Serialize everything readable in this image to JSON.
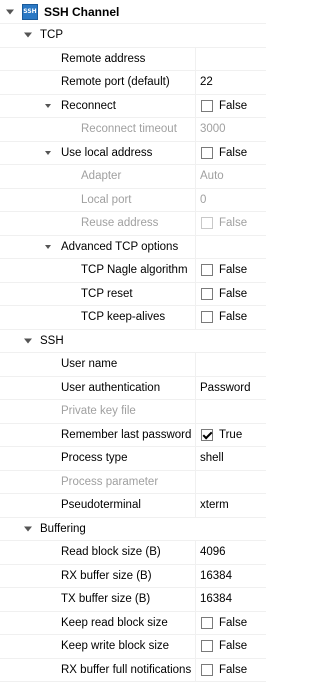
{
  "header": {
    "icon_text": "SSH",
    "title": "SSH Channel"
  },
  "tcp": {
    "label": "TCP",
    "remote_address": {
      "label": "Remote address",
      "value": ""
    },
    "remote_port": {
      "label": "Remote port (default)",
      "value": "22"
    },
    "reconnect": {
      "label": "Reconnect",
      "value": "False",
      "checked": false
    },
    "reconnect_timeout": {
      "label": "Reconnect timeout",
      "value": "3000"
    },
    "use_local_address": {
      "label": "Use local address",
      "value": "False",
      "checked": false
    },
    "adapter": {
      "label": "Adapter",
      "value": "Auto"
    },
    "local_port": {
      "label": "Local port",
      "value": "0"
    },
    "reuse_address": {
      "label": "Reuse address",
      "value": "False",
      "checked": false
    },
    "advanced": {
      "label": "Advanced TCP options",
      "nagle": {
        "label": "TCP Nagle algorithm",
        "value": "False",
        "checked": false
      },
      "reset": {
        "label": "TCP reset",
        "value": "False",
        "checked": false
      },
      "keepalives": {
        "label": "TCP keep-alives",
        "value": "False",
        "checked": false
      }
    }
  },
  "ssh": {
    "label": "SSH",
    "user_name": {
      "label": "User name",
      "value": ""
    },
    "user_authentication": {
      "label": "User authentication",
      "value": "Password"
    },
    "private_key_file": {
      "label": "Private key file",
      "value": ""
    },
    "remember_password": {
      "label": "Remember last password",
      "value": "True",
      "checked": true
    },
    "process_type": {
      "label": "Process type",
      "value": "shell"
    },
    "process_parameter": {
      "label": "Process parameter",
      "value": ""
    },
    "pseudoterminal": {
      "label": "Pseudoterminal",
      "value": "xterm"
    }
  },
  "buffering": {
    "label": "Buffering",
    "read_block_size": {
      "label": "Read block size (B)",
      "value": "4096"
    },
    "rx_buffer_size": {
      "label": "RX buffer size (B)",
      "value": "16384"
    },
    "tx_buffer_size": {
      "label": "TX buffer size (B)",
      "value": "16384"
    },
    "keep_read_block_size": {
      "label": "Keep read block size",
      "value": "False",
      "checked": false
    },
    "keep_write_block_size": {
      "label": "Keep write block size",
      "value": "False",
      "checked": false
    },
    "rx_full_notifications": {
      "label": "RX buffer full notifications",
      "value": "False",
      "checked": false
    }
  },
  "colors": {
    "disabled_text": "#a0a0a0",
    "grid_line": "#f0f0f0",
    "header_icon": "#2a78c4"
  }
}
